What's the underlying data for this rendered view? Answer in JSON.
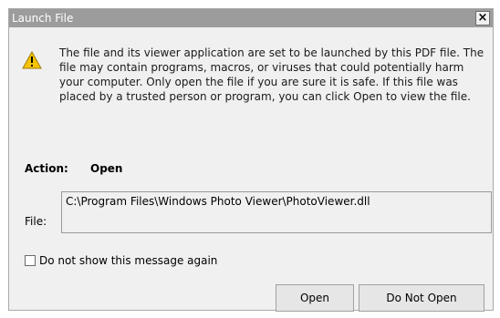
{
  "dialog": {
    "title": "Launch File",
    "close_glyph": "×",
    "icon": "warning-icon",
    "message": "The file and its viewer application are set to be launched by this PDF file. The file may contain programs, macros, or viruses that could potentially harm your computer. Only open the file if you are sure it is safe. If this file was placed by a trusted person or program, you can click Open to view the file.",
    "action_label": "Action:",
    "action_value": "Open",
    "file_label": "File:",
    "file_path": "C:\\Program Files\\Windows Photo Viewer\\PhotoViewer.dll",
    "checkbox_label": "Do not show this message again",
    "checkbox_checked": false,
    "buttons": {
      "open": "Open",
      "do_not_open": "Do Not Open"
    }
  },
  "colors": {
    "titlebar": "#9c9c9c",
    "background": "#f0f0f0",
    "warning": "#f5c400"
  }
}
